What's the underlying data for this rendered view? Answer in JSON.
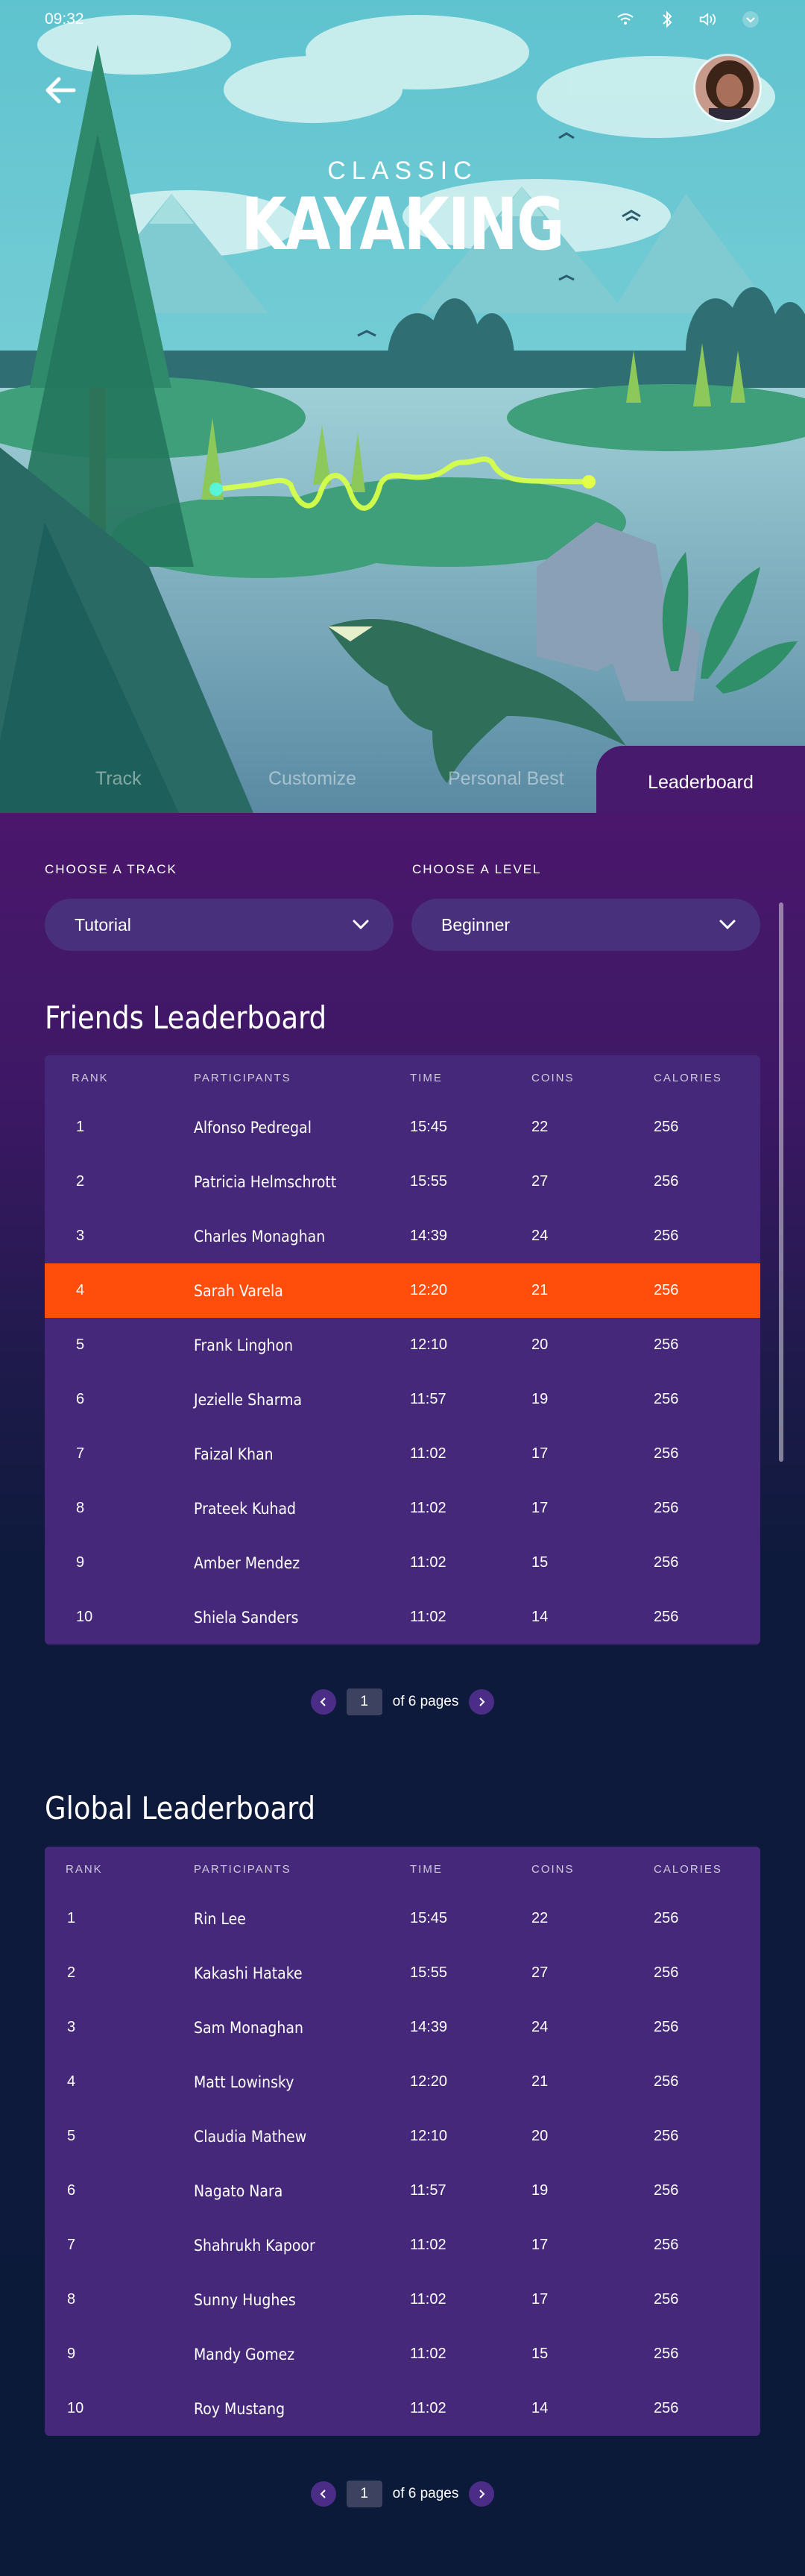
{
  "status_bar": {
    "time": "09:32"
  },
  "hero": {
    "title_small": "CLASSIC",
    "title_big": "KAYAKING"
  },
  "tabs": [
    {
      "label": "Track"
    },
    {
      "label": "Customize"
    },
    {
      "label": "Personal Best"
    },
    {
      "label": "Leaderboard",
      "active": true
    }
  ],
  "filters": {
    "track_label": "CHOOSE A TRACK",
    "track_value": "Tutorial",
    "level_label": "CHOOSE A LEVEL",
    "level_value": "Beginner"
  },
  "columns": {
    "rank": "RANK",
    "participants": "PARTICIPANTS",
    "time": "TIME",
    "coins": "COINS",
    "calories": "CALORIES"
  },
  "friends": {
    "title": "Friends Leaderboard",
    "rows": [
      {
        "rank": "1",
        "name": "Alfonso Pedregal",
        "time": "15:45",
        "coins": "22",
        "calories": "256"
      },
      {
        "rank": "2",
        "name": "Patricia Helmschrott",
        "time": "15:55",
        "coins": "27",
        "calories": "256"
      },
      {
        "rank": "3",
        "name": "Charles Monaghan",
        "time": "14:39",
        "coins": "24",
        "calories": "256"
      },
      {
        "rank": "4",
        "name": "Sarah Varela",
        "time": "12:20",
        "coins": "21",
        "calories": "256",
        "highlight": true
      },
      {
        "rank": "5",
        "name": "Frank Linghon",
        "time": "12:10",
        "coins": "20",
        "calories": "256"
      },
      {
        "rank": "6",
        "name": "Jezielle Sharma",
        "time": "11:57",
        "coins": "19",
        "calories": "256"
      },
      {
        "rank": "7",
        "name": "Faizal Khan",
        "time": "11:02",
        "coins": "17",
        "calories": "256"
      },
      {
        "rank": "8",
        "name": "Prateek Kuhad",
        "time": "11:02",
        "coins": "17",
        "calories": "256"
      },
      {
        "rank": "9",
        "name": "Amber Mendez",
        "time": "11:02",
        "coins": "15",
        "calories": "256"
      },
      {
        "rank": "10",
        "name": "Shiela Sanders",
        "time": "11:02",
        "coins": "14",
        "calories": "256"
      }
    ],
    "pager": {
      "current": "1",
      "of_text": "of 6 pages"
    }
  },
  "global": {
    "title": "Global Leaderboard",
    "rows": [
      {
        "rank": "1",
        "name": "Rin Lee",
        "time": "15:45",
        "coins": "22",
        "calories": "256"
      },
      {
        "rank": "2",
        "name": "Kakashi Hatake",
        "time": "15:55",
        "coins": "27",
        "calories": "256"
      },
      {
        "rank": "3",
        "name": "Sam Monaghan",
        "time": "14:39",
        "coins": "24",
        "calories": "256"
      },
      {
        "rank": "4",
        "name": "Matt Lowinsky",
        "time": "12:20",
        "coins": "21",
        "calories": "256"
      },
      {
        "rank": "5",
        "name": "Claudia Mathew",
        "time": "12:10",
        "coins": "20",
        "calories": "256"
      },
      {
        "rank": "6",
        "name": "Nagato Nara",
        "time": "11:57",
        "coins": "19",
        "calories": "256"
      },
      {
        "rank": "7",
        "name": "Shahrukh Kapoor",
        "time": "11:02",
        "coins": "17",
        "calories": "256"
      },
      {
        "rank": "8",
        "name": "Sunny Hughes",
        "time": "11:02",
        "coins": "17",
        "calories": "256"
      },
      {
        "rank": "9",
        "name": "Mandy Gomez",
        "time": "11:02",
        "coins": "15",
        "calories": "256"
      },
      {
        "rank": "10",
        "name": "Roy Mustang",
        "time": "11:02",
        "coins": "14",
        "calories": "256"
      }
    ],
    "pager": {
      "current": "1",
      "of_text": "of 6 pages"
    }
  },
  "colors": {
    "accent": "#ff4d0c",
    "panel": "#45287a",
    "track_glow": "#c8f53a"
  },
  "icons": [
    "wifi-icon",
    "bluetooth-icon",
    "volume-icon",
    "chevron-down-icon",
    "back-arrow-icon",
    "chevron-left-icon",
    "chevron-right-icon"
  ]
}
